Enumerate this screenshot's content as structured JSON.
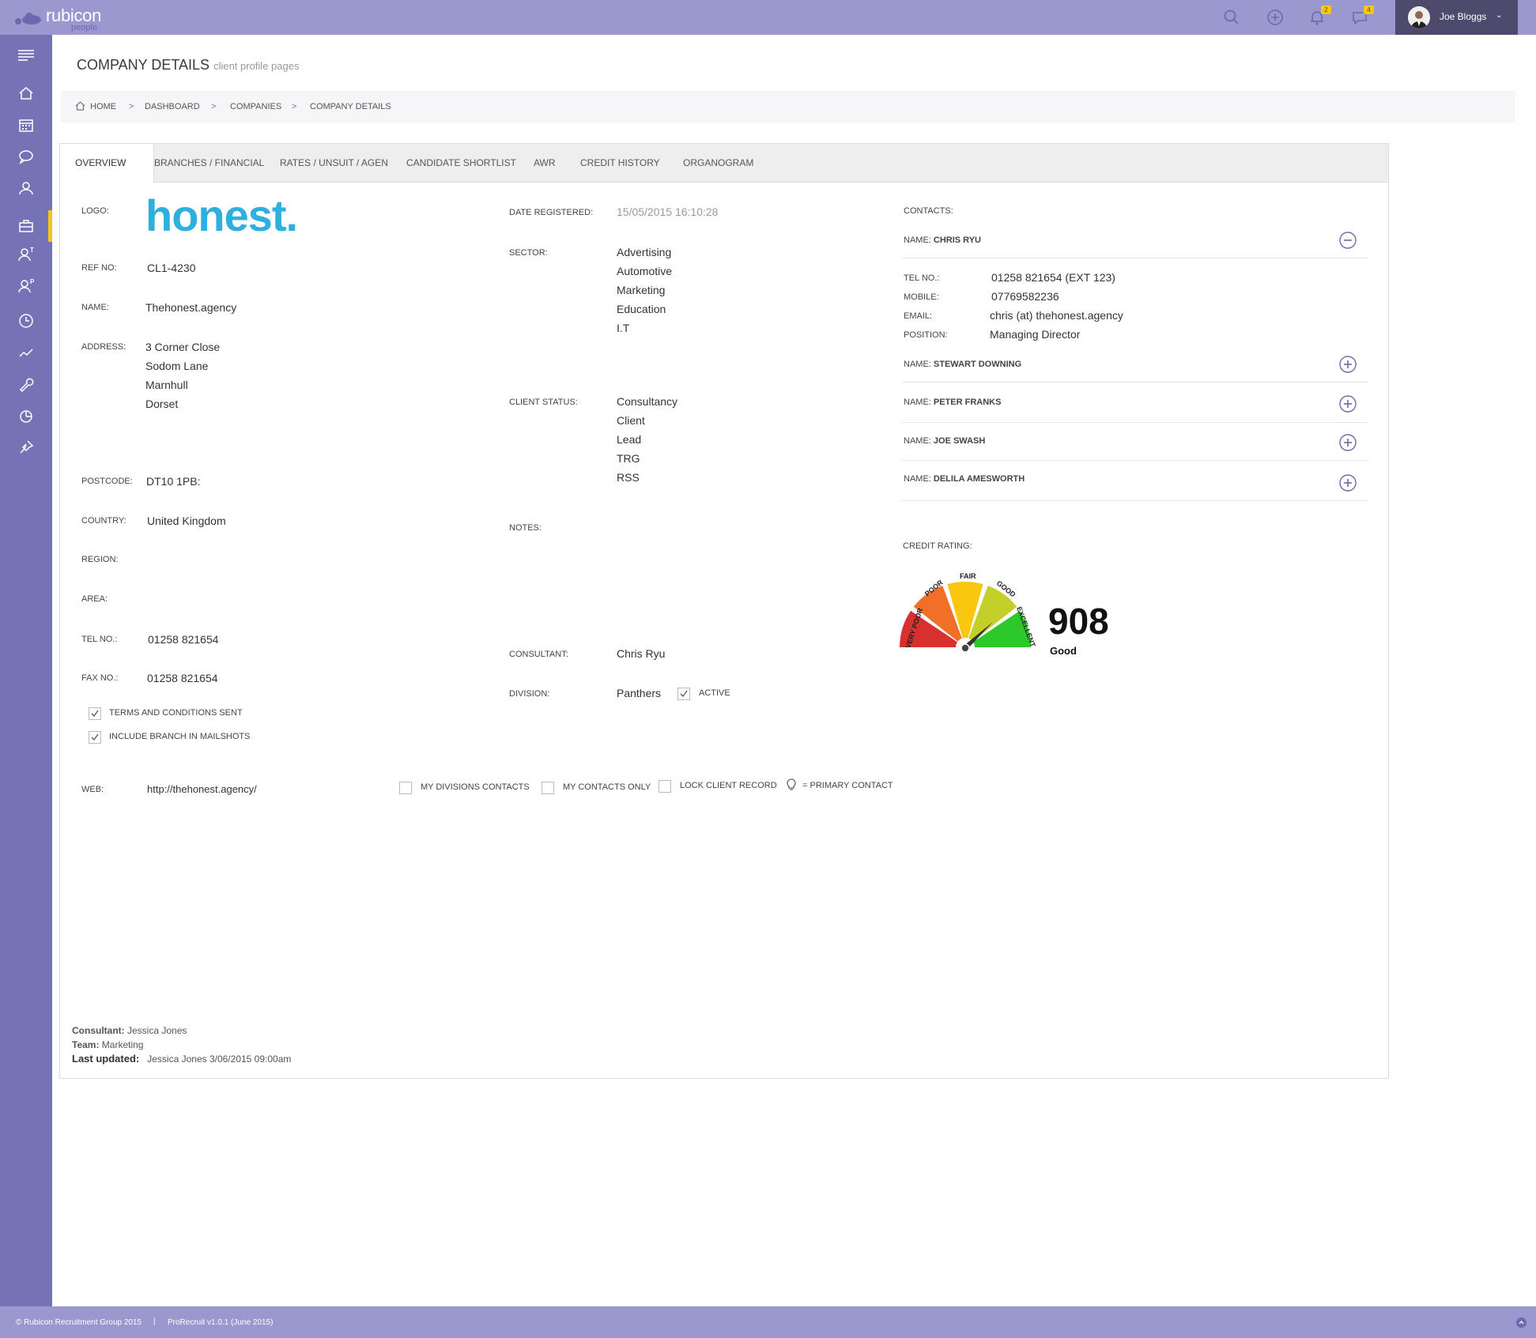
{
  "app": {
    "brand": "rubicon",
    "brand_sub": "people",
    "notif_count": "2",
    "msg_count": "4",
    "user_name": "Joe Bloggs",
    "icons": [
      "search-icon",
      "add-icon",
      "bell-icon",
      "chat-icon"
    ]
  },
  "sidebar": {
    "icons": [
      "menu-icon",
      "home-icon",
      "calendar-icon",
      "chat-icon",
      "contacts-icon",
      "briefcase-icon",
      "temp-user-icon",
      "perm-user-icon",
      "clock-icon",
      "chart-icon",
      "wrench-icon",
      "pie-icon",
      "pin-icon"
    ],
    "active_color": "#f5c518"
  },
  "page": {
    "title": "COMPANY DETAILS",
    "subtitle": "client profile pages"
  },
  "breadcrumb": [
    "HOME",
    "DASHBOARD",
    "COMPANIES",
    "COMPANY DETAILS"
  ],
  "tabs": [
    "OVERVIEW",
    "BRANCHES / FINANCIAL",
    "RATES / UNSUIT / AGEN",
    "CANDIDATE SHORTLIST",
    "AWR",
    "CREDIT HISTORY",
    "ORGANOGRAM"
  ],
  "company": {
    "logo_label": "LOGO:",
    "logo_text": "honest.",
    "ref_label": "REF NO:",
    "ref": "CL1-4230",
    "name_label": "NAME:",
    "name": "Thehonest.agency",
    "address_label": "ADDRESS:",
    "address": [
      "3 Corner Close",
      "Sodom Lane",
      "Marnhull",
      "Dorset"
    ],
    "postcode_label": "POSTCODE:",
    "postcode": "DT10 1PB:",
    "country_label": "COUNTRY:",
    "country": "United Kingdom",
    "region_label": "REGION:",
    "area_label": "AREA:",
    "tel_label": "TEL NO.:",
    "tel": "01258 821654",
    "fax_label": "FAX NO.:",
    "fax": "01258 821654",
    "terms_label": "TERMS AND CONDITIONS SENT",
    "mailshots_label": "INCLUDE BRANCH IN MAILSHOTS",
    "web_label": "WEB:",
    "web": "http://thehonest.agency/"
  },
  "middle": {
    "date_label": "DATE REGISTERED:",
    "date": "15/05/2015  16:10:28",
    "sector_label": "SECTOR:",
    "sectors": [
      "Advertising",
      "Automotive",
      "Marketing",
      "Education",
      "I.T"
    ],
    "status_label": "CLIENT STATUS:",
    "statuses": [
      "Consultancy",
      "Client",
      "Lead",
      "TRG",
      "RSS"
    ],
    "notes_label": "NOTES:",
    "consultant_label": "CONSULTANT:",
    "consultant": "Chris Ryu",
    "division_label": "DIVISION:",
    "division": "Panthers",
    "active_label": "ACTIVE"
  },
  "options": {
    "my_divisions": "MY DIVISIONS CONTACTS",
    "my_contacts": "MY CONTACTS ONLY",
    "lock": "LOCK CLIENT RECORD",
    "primary": "= PRIMARY CONTACT"
  },
  "contacts": {
    "label": "CONTACTS:",
    "name_prefix": "NAME:",
    "expanded": {
      "name": "CHRIS RYU",
      "tel_label": "TEL NO.:",
      "tel": "01258 821654 (EXT 123)",
      "mobile_label": "MOBILE:",
      "mobile": "07769582236",
      "email_label": "EMAIL:",
      "email": "chris (at) thehonest.agency",
      "position_label": "POSITION:",
      "position": "Managing Director"
    },
    "others": [
      "STEWART DOWNING",
      "PETER FRANKS",
      "JOE SWASH",
      "DELILA AMESWORTH"
    ]
  },
  "credit": {
    "label": "CREDIT RATING:",
    "score": "908",
    "rating": "Good",
    "segments": [
      "VERY POOR",
      "POOR",
      "FAIR",
      "GOOD",
      "EXCELLENT"
    ],
    "colors": [
      "#d8302f",
      "#f26f28",
      "#f9c80e",
      "#c5cf2a",
      "#2dc92a"
    ]
  },
  "footer_meta": {
    "consultant_label": "Consultant:",
    "consultant": "Jessica Jones",
    "team_label": "Team:",
    "team": "Marketing",
    "updated_label": "Last updated:",
    "updated": "Jessica Jones 3/06/2015  09:00am"
  },
  "footer": {
    "copyright": "© Rubicon Recruitment Group 2015",
    "sep": "|",
    "version": "ProRecruit v1.0.1 (June 2015)"
  }
}
